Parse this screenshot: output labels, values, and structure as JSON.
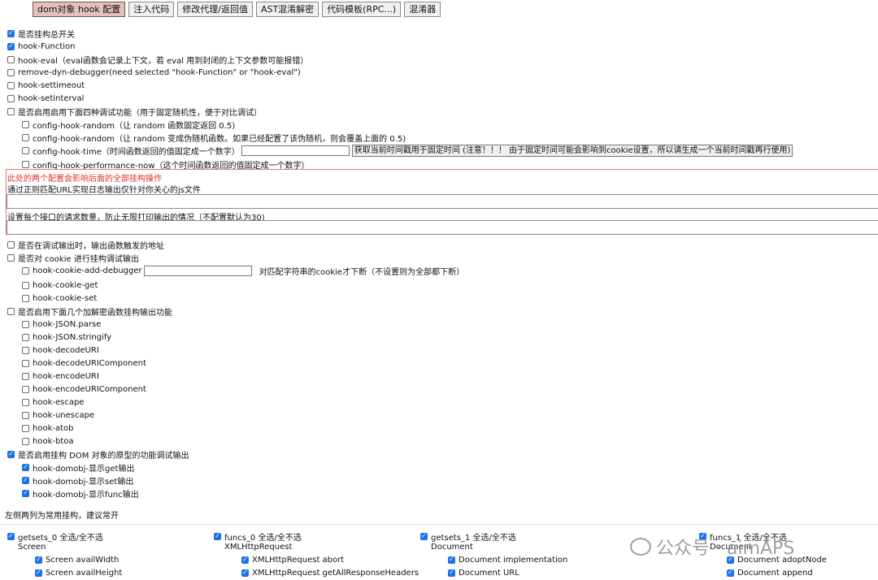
{
  "tabs": [
    "dom对象 hook 配置",
    "注入代码",
    "修改代理/返回值",
    "AST混淆解密",
    "代码模板(RPC...)",
    "混淆器"
  ],
  "options": [
    {
      "label": "是否挂构总开关",
      "checked": true
    },
    {
      "label": "hook-Function",
      "checked": true
    },
    {
      "label": "hook-eval（eval函数会记录上下文，若 eval 用到封闭的上下文参数可能报错）",
      "checked": false
    },
    {
      "label": "remove-dyn-debugger(need selected \"hook-Function\" or \"hook-eval\")",
      "checked": false
    },
    {
      "label": "hook-settimeout",
      "checked": false
    },
    {
      "label": "hook-setinterval",
      "checked": false
    },
    {
      "label": "是否启用启用下面四种调试功能（用于固定随机性，便于对比调试）",
      "checked": false
    },
    {
      "label": "config-hook-random（让 random 函数固定返回 0.5)",
      "checked": false
    },
    {
      "label": "config-hook-random（让 random 变成伪随机函数。如果已经配置了该伪随机，则会覆盖上面的 0.5)",
      "checked": false
    },
    {
      "label": "config-hook-time（时间函数返回的值固定成一个数字）",
      "checked": false
    },
    {
      "label": "config-hook-performance-now（这个时间函数返回的值固定成一个数字）",
      "checked": false
    }
  ],
  "time_button": "获取当前时间戳用于固定时间 (注意！！！ 由于固定时间可能会影响到cookie设置，所以请生成一个当前时间戳再行使用)",
  "red_note": "此处的两个配置会影响后面的全部挂构操作",
  "url_regex_label": "通过正则匹配URL实现日志输出仅针对你关心的js文件",
  "request_limit_label": "设置每个接口的请求数量，防止无限打印输出的情况（不配置默认为30)",
  "options2": [
    {
      "label": "是否在调试输出时，输出函数触发的地址",
      "checked": false
    },
    {
      "label": "是否对 cookie 进行挂构调试输出",
      "checked": false
    },
    {
      "label": "hook-cookie-add-debugger",
      "checked": false
    },
    {
      "label": "hook-cookie-get",
      "checked": false
    },
    {
      "label": "hook-cookie-set",
      "checked": false
    },
    {
      "label": "是否启用下面几个加解密函数挂构输出功能",
      "checked": false
    },
    {
      "label": "hook-JSON.parse",
      "checked": false
    },
    {
      "label": "hook-JSON.stringify",
      "checked": false
    },
    {
      "label": "hook-decodeURI",
      "checked": false
    },
    {
      "label": "hook-decodeURIComponent",
      "checked": false
    },
    {
      "label": "hook-encodeURI",
      "checked": false
    },
    {
      "label": "hook-encodeURIComponent",
      "checked": false
    },
    {
      "label": "hook-escape",
      "checked": false
    },
    {
      "label": "hook-unescape",
      "checked": false
    },
    {
      "label": "hook-atob",
      "checked": false
    },
    {
      "label": "hook-btoa",
      "checked": false
    },
    {
      "label": "是否启用挂构 DOM 对象的原型的功能调试输出",
      "checked": true
    },
    {
      "label": "hook-domobj-显示get输出",
      "checked": true
    },
    {
      "label": "hook-domobj-显示set输出",
      "checked": true
    },
    {
      "label": "hook-domobj-显示func输出",
      "checked": true
    }
  ],
  "cookie_filter_note": "对匹配字符串的cookie才下断（不设置则为全部都下断）",
  "columns_note": "左侧两列为常用挂构，建议常开",
  "groups": [
    {
      "label": "getsets_0 全选/全不选",
      "object": "Screen",
      "items": [
        "Screen availWidth",
        "Screen availHeight"
      ]
    },
    {
      "label": "funcs_0 全选/全不选",
      "object": "XMLHttpRequest",
      "items": [
        "XMLHttpRequest abort",
        "XMLHttpRequest getAllResponseHeaders"
      ]
    },
    {
      "label": "getsets_1 全选/全不选",
      "object": "Document",
      "items": [
        "Document implementation",
        "Document URL"
      ]
    },
    {
      "label": "funcs_1 全选/全不选",
      "object": "Document",
      "items": [
        "Document adoptNode",
        "Document append"
      ]
    }
  ],
  "watermark": "公众号 · aimAPS",
  "colors": {
    "active_tab": "#e8bfbf",
    "checkbox_on": "#1a73e8",
    "red": "#e03030"
  }
}
